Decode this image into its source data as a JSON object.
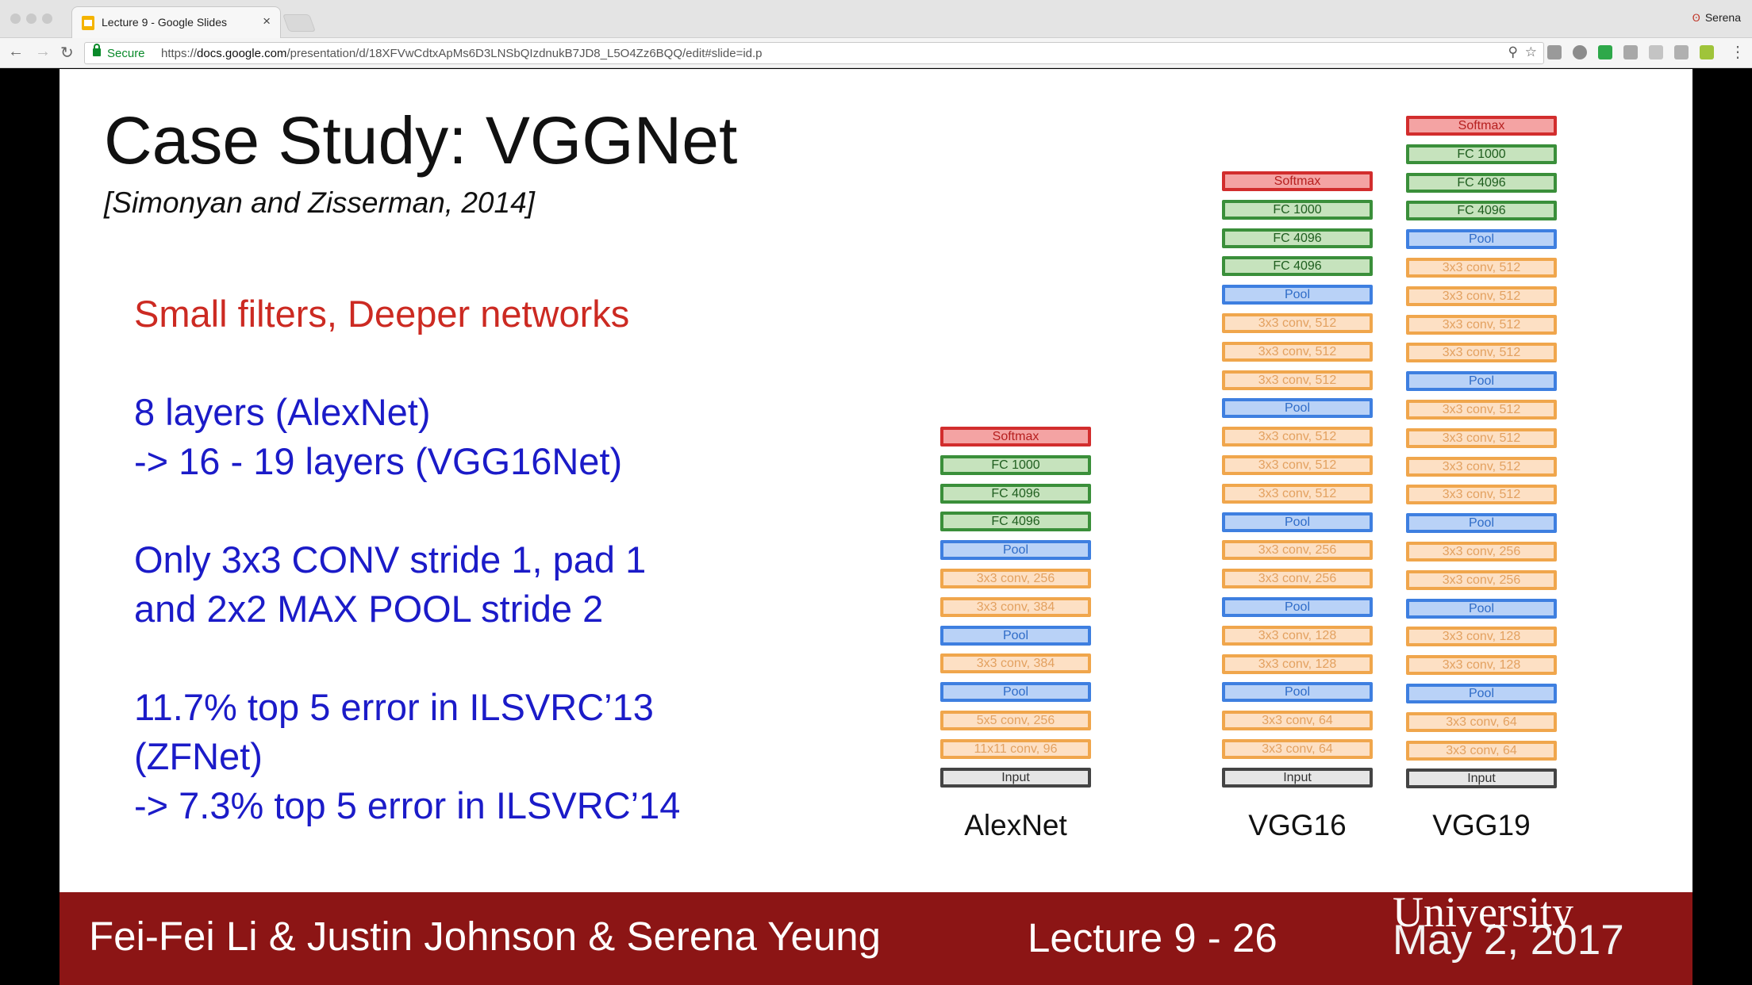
{
  "browser": {
    "tab_title": "Lecture 9 - Google Slides",
    "tab_close": "×",
    "profile_name": "Serena",
    "profile_icon": "Ꙩ",
    "secure_label": "Secure",
    "url_scheme": "https://",
    "url_host": "docs.google.com",
    "url_path": "/presentation/d/18XFVwCdtxApMs6D3LNSbQIzdnukB7JD8_L5O4Zz6BQQ/edit#slide=id.p",
    "back_glyph": "←",
    "forward_glyph": "→",
    "reload_glyph": "↻",
    "zoom_glyph": "⚲",
    "star_glyph": "☆",
    "menu_glyph": "⋮"
  },
  "slide": {
    "title": "Case Study: VGGNet",
    "subtitle": "[Simonyan and Zisserman, 2014]",
    "points": [
      "Small filters, Deeper networks",
      "8 layers (AlexNet)",
      "-> 16 - 19 layers (VGG16Net)",
      "Only 3x3 CONV stride 1, pad 1",
      "and  2x2 MAX POOL stride 2",
      "11.7% top 5 error in ILSVRC’13",
      "(ZFNet)",
      "-> 7.3% top 5 error in ILSVRC’14"
    ],
    "colors": {
      "accent_red": "#cc2a22",
      "accent_blue": "#1b1bc8",
      "footer_bg": "#8c1515"
    },
    "architectures": [
      {
        "name": "AlexNet",
        "layers": [
          "Softmax",
          "FC 1000",
          "FC 4096",
          "FC 4096",
          "Pool",
          "3x3 conv, 256",
          "3x3 conv, 384",
          "Pool",
          "3x3 conv, 384",
          "Pool",
          "5x5 conv, 256",
          "11x11 conv, 96",
          "Input"
        ],
        "types": [
          "softmax",
          "fc",
          "fc",
          "fc",
          "pool",
          "conv",
          "conv",
          "pool",
          "conv",
          "pool",
          "conv",
          "conv",
          "input"
        ]
      },
      {
        "name": "VGG16",
        "layers": [
          "Softmax",
          "FC 1000",
          "FC 4096",
          "FC 4096",
          "Pool",
          "3x3 conv, 512",
          "3x3 conv, 512",
          "3x3 conv, 512",
          "Pool",
          "3x3 conv, 512",
          "3x3 conv, 512",
          "3x3 conv, 512",
          "Pool",
          "3x3 conv, 256",
          "3x3 conv, 256",
          "Pool",
          "3x3 conv, 128",
          "3x3 conv, 128",
          "Pool",
          "3x3 conv, 64",
          "3x3 conv, 64",
          "Input"
        ],
        "types": [
          "softmax",
          "fc",
          "fc",
          "fc",
          "pool",
          "conv",
          "conv",
          "conv",
          "pool",
          "conv",
          "conv",
          "conv",
          "pool",
          "conv",
          "conv",
          "pool",
          "conv",
          "conv",
          "pool",
          "conv",
          "conv",
          "input"
        ]
      },
      {
        "name": "VGG19",
        "layers": [
          "Softmax",
          "FC 1000",
          "FC 4096",
          "FC 4096",
          "Pool",
          "3x3 conv, 512",
          "3x3 conv, 512",
          "3x3 conv, 512",
          "3x3 conv, 512",
          "Pool",
          "3x3 conv, 512",
          "3x3 conv, 512",
          "3x3 conv, 512",
          "3x3 conv, 512",
          "Pool",
          "3x3 conv, 256",
          "3x3 conv, 256",
          "Pool",
          "3x3 conv, 128",
          "3x3 conv, 128",
          "Pool",
          "3x3 conv, 64",
          "3x3 conv, 64",
          "Input"
        ],
        "types": [
          "softmax",
          "fc",
          "fc",
          "fc",
          "pool",
          "conv",
          "conv",
          "conv",
          "conv",
          "pool",
          "conv",
          "conv",
          "conv",
          "conv",
          "pool",
          "conv",
          "conv",
          "pool",
          "conv",
          "conv",
          "pool",
          "conv",
          "conv",
          "input"
        ]
      }
    ],
    "footer": {
      "authors": "Fei-Fei Li & Justin Johnson & Serena Yeung",
      "lecture": "Lecture 9 - 26",
      "date": "May 2, 2017",
      "wordmark": "University"
    }
  }
}
